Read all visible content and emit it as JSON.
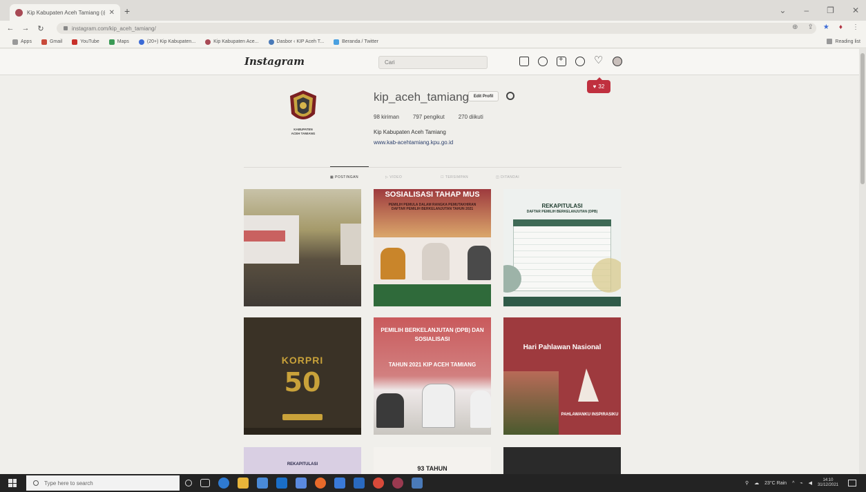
{
  "browser": {
    "tab_title": "Kip Kabupaten Aceh Tamiang (@",
    "tab_close": "✕",
    "new_tab": "+",
    "url": "instagram.com/kip_aceh_tamiang/",
    "window_buttons": [
      "⌄",
      "–",
      "❐",
      "✕"
    ],
    "bookmarks": [
      "Apps",
      "Gmail",
      "YouTube",
      "Maps",
      "(20+) Kip Kabupaten...",
      "Kip Kabupaten Ace...",
      "Dasbor ‹ KIP Aceh T...",
      "Beranda / Twitter"
    ],
    "reading_list": "Reading list",
    "colors": {
      "accent": "#3c6bd6",
      "tab_favicon": "#a84a55"
    }
  },
  "instagram": {
    "logo": "Instagram",
    "search_placeholder": "Cari",
    "nav_icons": [
      "home-icon",
      "messenger-icon",
      "new-post-icon",
      "explore-icon",
      "activity-icon",
      "profile-avatar-icon"
    ],
    "notification": {
      "icon": "heart-icon",
      "count": "32"
    },
    "profile": {
      "logo_caption_line1": "KABUPATEN",
      "logo_caption_line2": "ACEH TAMIANG",
      "username": "kip_aceh_tamiang",
      "edit_profile": "Edit Profil",
      "posts": "98 kiriman",
      "followers": "797 pengikut",
      "following": "270 diikuti",
      "full_name": "Kip Kabupaten Aceh Tamiang",
      "website": "www.kab-acehtamiang.kpu.go.id"
    },
    "profile_tabs": [
      "▦ POSTINGAN",
      "▷ VIDEO",
      "☐ TERSIMPAN",
      "◫ DITANDAI"
    ],
    "posts": [
      {
        "text": "",
        "subtext": ""
      },
      {
        "text": "SOSIALISASI TAHAP MUS",
        "subtext": "PEMILIH PEMULA DALAM RANGKA PEMUTAKHIRAN DAFTAR PEMILIH BERKELANJUTAN TAHUN 2021"
      },
      {
        "text": "REKAPITULASI",
        "subtext": "DAFTAR PEMILIH BERKELANJUTAN (DPB)"
      },
      {
        "text": "KORPRI",
        "subtext": "50"
      },
      {
        "text": "PEMILIH BERKELANJUTAN (DPB) DAN SOSIALISASI",
        "subtext": "TAHUN 2021 KIP ACEH TAMIANG"
      },
      {
        "text": "Hari Pahlawan Nasional",
        "subtext": "PAHLAWANKU INSPIRASIKU"
      },
      {
        "text": "REKAPITULASI",
        "subtext": ""
      },
      {
        "text": "93 TAHUN",
        "subtext": ""
      },
      {
        "text": "",
        "subtext": ""
      }
    ],
    "colors": {
      "notification": "#c0303f",
      "post_red": "#9e3a3e",
      "korpri_bg": "#3a3226",
      "korpri_gold": "#c9a23a"
    }
  },
  "taskbar": {
    "search_placeholder": "Type here to search",
    "weather": "23°C Rain",
    "time": "14:10",
    "date": "31/12/2021"
  }
}
